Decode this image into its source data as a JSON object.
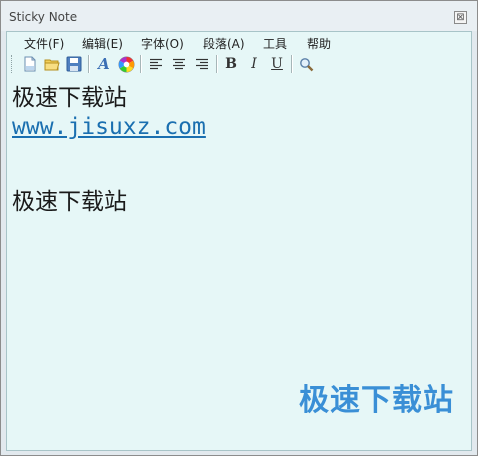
{
  "window": {
    "title": "Sticky Note",
    "close_glyph": "⊠"
  },
  "menubar": {
    "items": [
      {
        "label": "文件(F)"
      },
      {
        "label": "编辑(E)"
      },
      {
        "label": "字体(O)"
      },
      {
        "label": "段落(A)"
      },
      {
        "label": "工具"
      },
      {
        "label": "帮助"
      }
    ]
  },
  "toolbar": {
    "bold": "B",
    "italic": "I",
    "underline": "U",
    "font_glyph": "A"
  },
  "content": {
    "lines": [
      "极速下载站",
      "www.jisuxz.com",
      "",
      "极速下载站"
    ]
  },
  "watermark": "极速下载站"
}
